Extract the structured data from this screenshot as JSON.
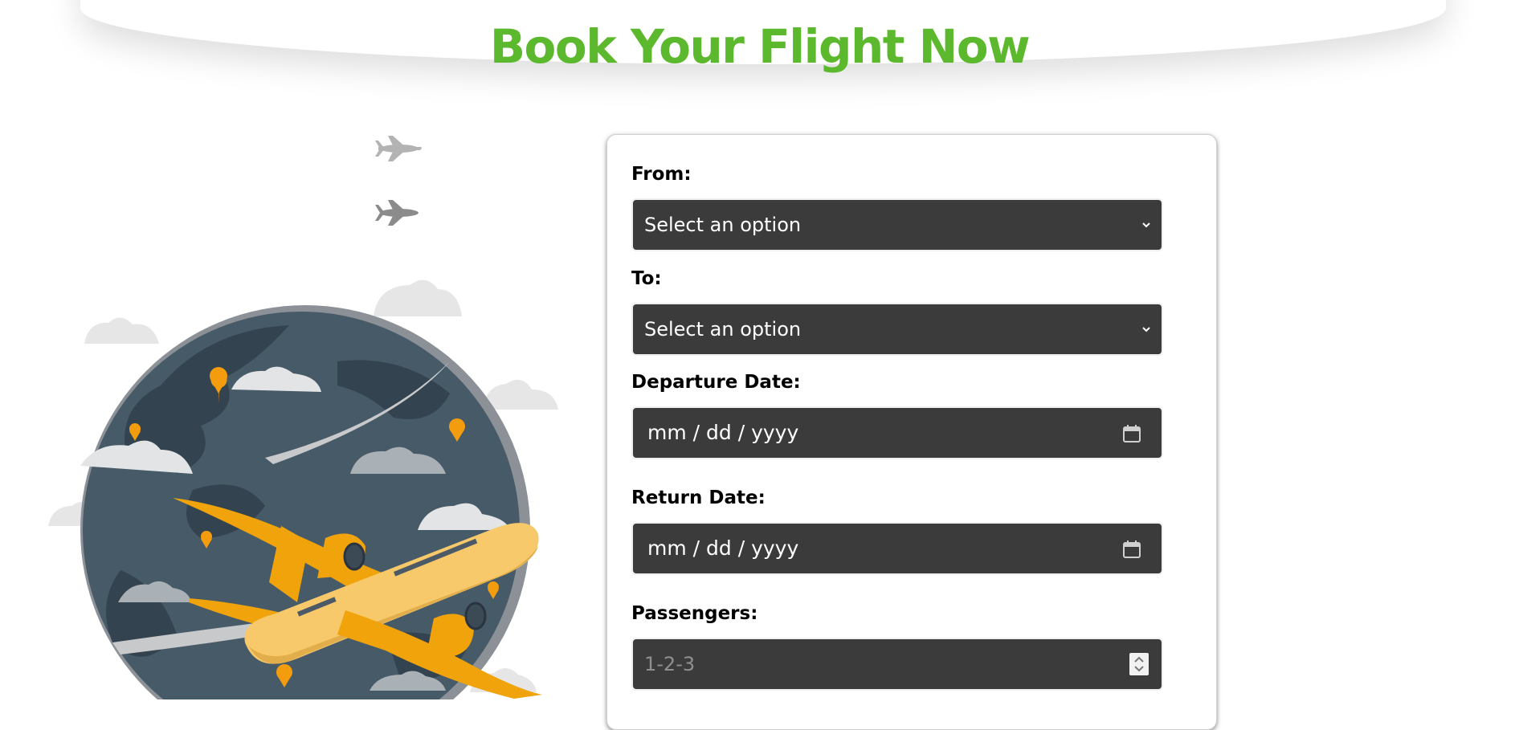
{
  "page": {
    "title": "Book Your Flight Now",
    "accent_color": "#5cb82c"
  },
  "illustration": {
    "icons": [
      "plane-icon",
      "plane-icon",
      "globe-icon",
      "airplane-icon",
      "location-pin-icon",
      "cloud-icon"
    ]
  },
  "form": {
    "from": {
      "label": "From:",
      "value": "Select an option"
    },
    "to": {
      "label": "To:",
      "value": "Select an option"
    },
    "departure": {
      "label": "Departure Date:",
      "placeholder": "mm / dd / yyyy"
    },
    "return": {
      "label": "Return Date:",
      "placeholder": "mm / dd / yyyy"
    },
    "passengers": {
      "label": "Passengers:",
      "placeholder": "1-2-3"
    }
  }
}
